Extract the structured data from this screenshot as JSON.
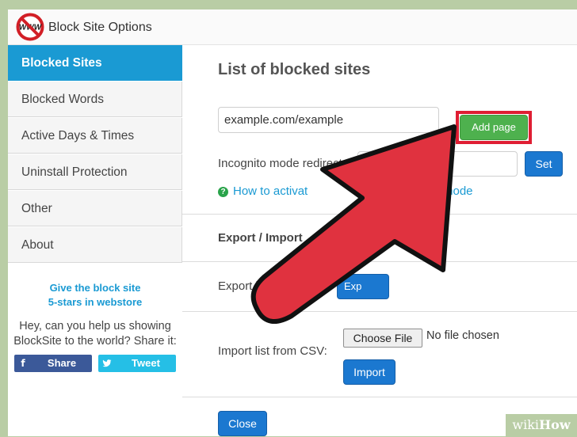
{
  "app": {
    "title": "Block Site Options",
    "logo_text": "WWW"
  },
  "sidebar": {
    "items": [
      {
        "label": "Blocked Sites",
        "active": true
      },
      {
        "label": "Blocked Words",
        "active": false
      },
      {
        "label": "Active Days & Times",
        "active": false
      },
      {
        "label": "Uninstall Protection",
        "active": false
      },
      {
        "label": "Other",
        "active": false
      },
      {
        "label": "About",
        "active": false
      }
    ],
    "promo_line1": "Give the block site",
    "promo_line2": "5-stars in webstore",
    "share_text_line1": "Hey, can you help us showing",
    "share_text_line2": "BlockSite to the world? Share it:",
    "share_buttons": [
      {
        "label": "Share",
        "icon": "facebook-icon",
        "glyph": "f",
        "color": "#3b5999"
      },
      {
        "label": "Tweet",
        "icon": "twitter-icon",
        "glyph": "❧",
        "color": "#25bfe6"
      }
    ]
  },
  "main": {
    "title": "List of blocked sites",
    "site_input_value": "example.com/example",
    "add_page_label": "Add page",
    "incognito_label": "Incognito mode redirect",
    "incognito_value": "",
    "set_label": "Set",
    "help_link_start": "How to activat",
    "help_link_end": "mode",
    "export_import_title": "Export / Import",
    "export_label": "Export list to",
    "export_button_visible": "Exp",
    "import_label": "Import list from CSV:",
    "choose_file_label": "Choose File",
    "no_file_text": "No file chosen",
    "import_button_label": "Import",
    "close_label": "Close"
  },
  "watermark": {
    "wiki": "wiki",
    "how": "How"
  },
  "colors": {
    "accent": "#1a9ad3",
    "primary_button": "#1b78d0",
    "add_button": "#4eb14e",
    "highlight": "#df1e33",
    "arrow_fill": "#e0323f",
    "page_frame": "#b9cda5"
  }
}
